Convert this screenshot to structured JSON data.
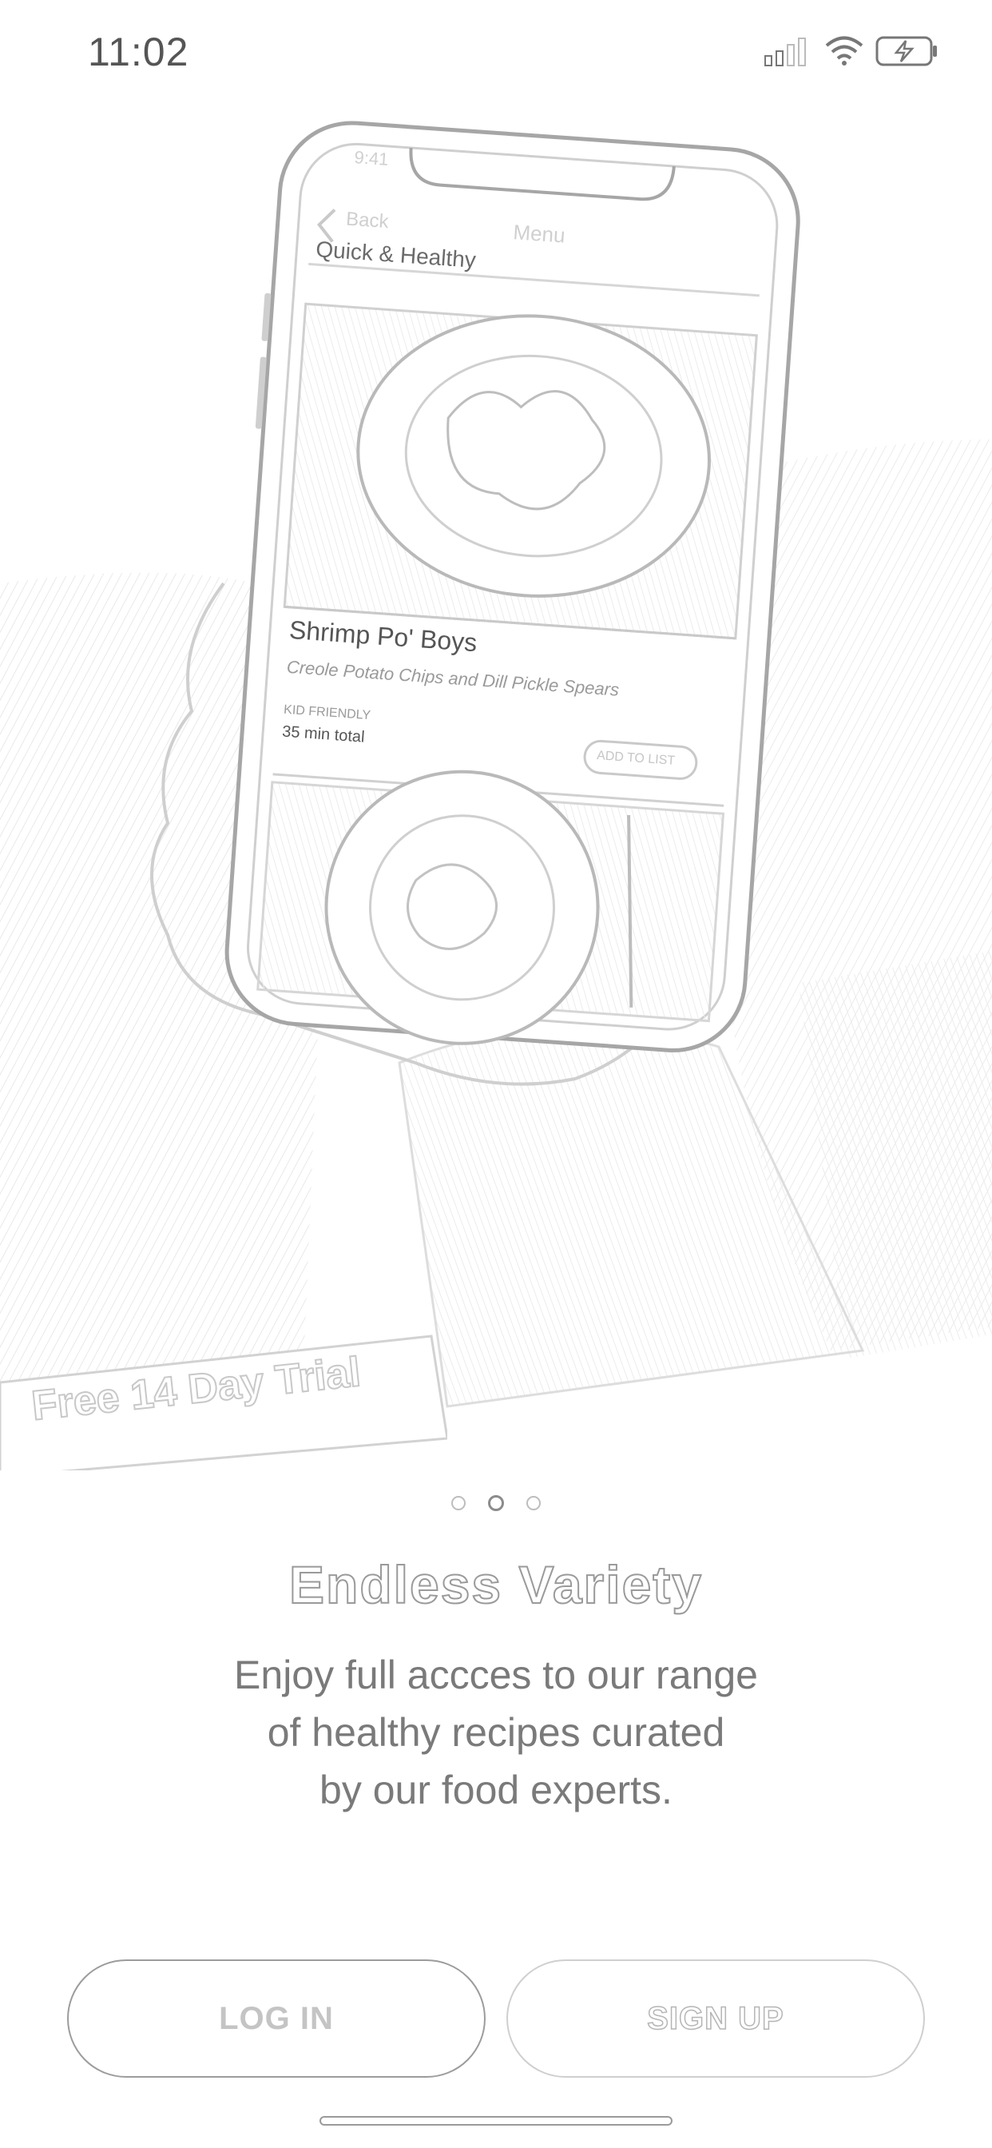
{
  "status_bar": {
    "time": "11:02",
    "icons": [
      "signal-icon",
      "wifi-icon",
      "battery-charging-icon"
    ]
  },
  "hero": {
    "mock_phone": {
      "time": "9:41",
      "back_label": "Back",
      "nav_title": "Menu",
      "section_title": "Quick & Healthy",
      "recipe_title": "Shrimp Po' Boys",
      "recipe_subtitle": "Creole Potato Chips and Dill Pickle Spears",
      "recipe_tag": "KID FRIENDLY",
      "recipe_time": "35 min total",
      "add_button_label": "ADD TO LIST"
    }
  },
  "trial_badge": {
    "label": "Free 14 Day Trial"
  },
  "pager": {
    "count": 3,
    "active_index": 1
  },
  "onboarding": {
    "headline": "Endless Variety",
    "body_lines": [
      "Enjoy full accces to our range",
      "of healthy recipes curated",
      "by our food experts."
    ]
  },
  "actions": {
    "login_label": "LOG IN",
    "signup_label": "SIGN UP"
  },
  "colors": {
    "outline": "#9a9a9a",
    "text": "#7a7a7a",
    "background": "#ffffff"
  }
}
